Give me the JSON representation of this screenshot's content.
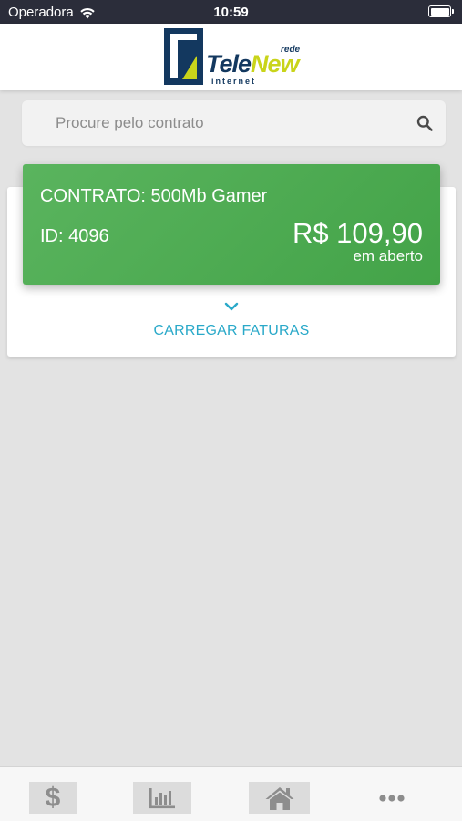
{
  "status_bar": {
    "carrier": "Operadora",
    "time": "10:59"
  },
  "header": {
    "logo": {
      "rede": "rede",
      "brand_part1": "Tele",
      "brand_part2": "New",
      "tagline": "internet"
    }
  },
  "search": {
    "placeholder": "Procure pelo contrato",
    "value": ""
  },
  "contract": {
    "title": "CONTRATO: 500Mb Gamer",
    "id": "ID: 4096",
    "amount": "R$ 109,90",
    "status": "em aberto"
  },
  "load_invoices": {
    "label": "CARREGAR FATURAS"
  },
  "tab_bar": {
    "tabs": [
      {
        "icon": "dollar-icon"
      },
      {
        "icon": "bar-chart-icon"
      },
      {
        "icon": "home-icon"
      },
      {
        "icon": "more-icon"
      }
    ]
  },
  "colors": {
    "accent_green": "#4caf50",
    "link_cyan": "#2aa9c9",
    "brand_navy": "#13385f",
    "brand_lime": "#c9d41a"
  }
}
